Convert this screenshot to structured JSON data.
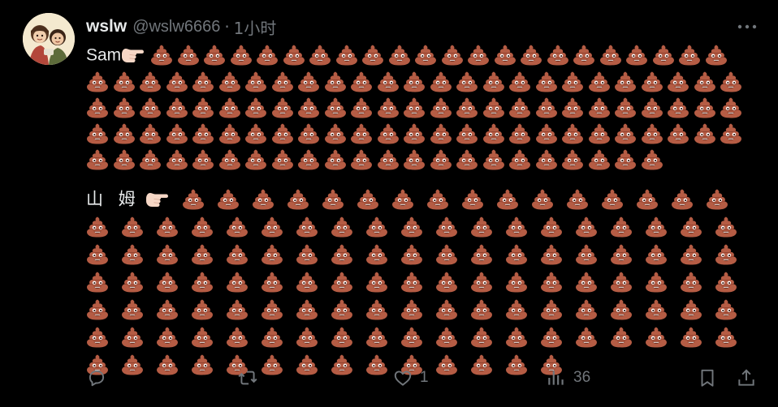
{
  "tweet": {
    "display_name": "wslw",
    "handle": "@wslw6666",
    "separator": "·",
    "time": "1小时",
    "line1_text": "Sam",
    "line2_text": "山 姆",
    "emoji_main": "pile-of-poo",
    "emoji_pointer": "backhand-index-pointing-left",
    "para1_poo_count": 119,
    "para2_poo_count": 125
  },
  "actions": {
    "reply_count": "",
    "retweet_count": "",
    "like_count": "1",
    "views_count": "36"
  },
  "colors": {
    "background": "#000000",
    "text": "#e7e9ea",
    "muted": "#71767b",
    "poo": "#b55c44"
  },
  "icons": [
    "more-icon",
    "reply-icon",
    "retweet-icon",
    "like-icon",
    "views-icon",
    "bookmark-icon",
    "share-icon",
    "poo-icon",
    "pointing-hand-icon"
  ]
}
